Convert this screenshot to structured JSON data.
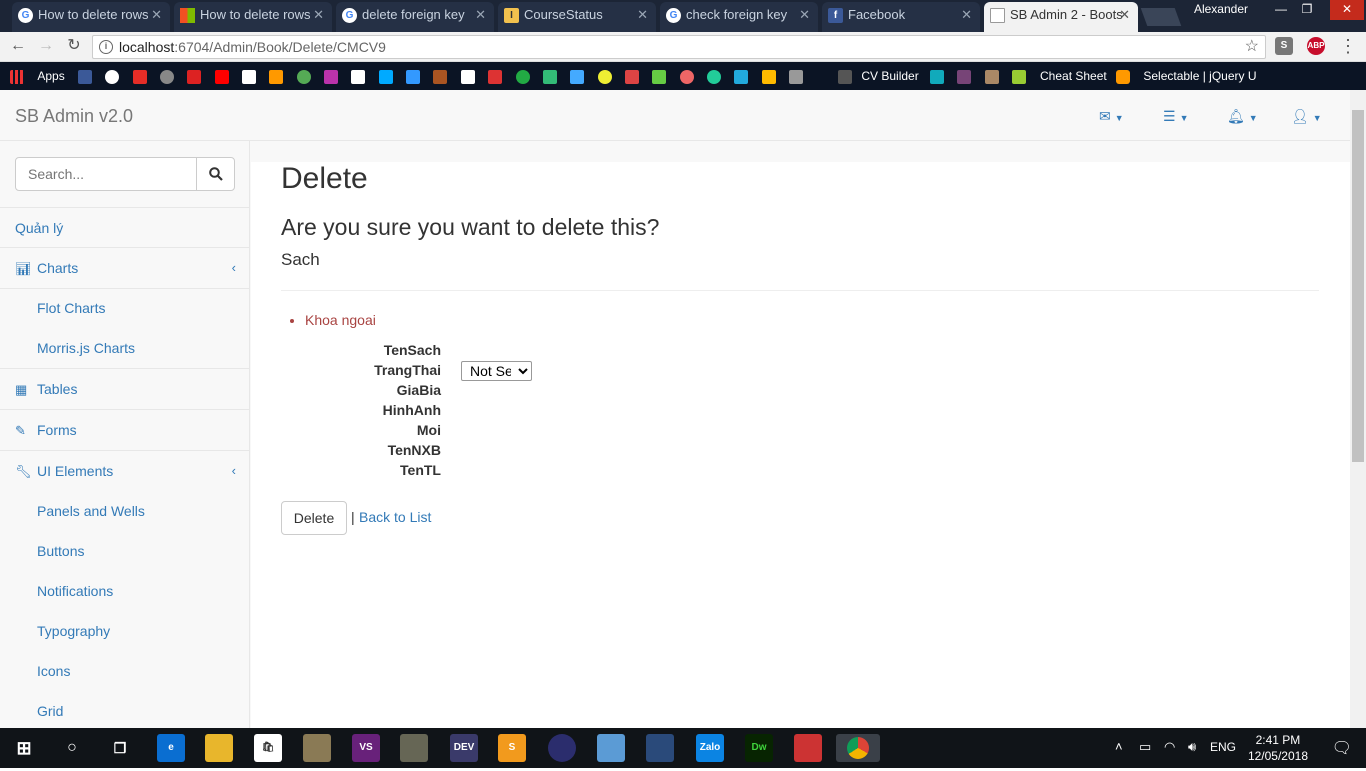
{
  "browser": {
    "tabs": [
      {
        "title": "How to delete rows",
        "fav": "google",
        "color": "#ffffff"
      },
      {
        "title": "How to delete rows",
        "fav": "microsoft",
        "color": "#ffffff"
      },
      {
        "title": "delete foreign key",
        "fav": "google",
        "color": "#ffffff"
      },
      {
        "title": "CourseStatus",
        "fav": "courses",
        "color": "#f2c14e"
      },
      {
        "title": "check foreign key",
        "fav": "google",
        "color": "#ffffff"
      },
      {
        "title": "Facebook",
        "fav": "facebook",
        "color": "#3b5998"
      },
      {
        "title": "SB Admin 2 - Boots",
        "fav": "page",
        "color": "#ffffff"
      }
    ],
    "profile_name": "Alexander",
    "url_host": "localhost",
    "url_path": ":6704/Admin/Book/Delete/CMCV9",
    "bookmarks": {
      "apps": "Apps",
      "cv_builder": "CV Builder",
      "cheat_sheet": "Cheat Sheet",
      "selectable": "Selectable | jQuery U"
    }
  },
  "app": {
    "brand": "SB Admin v2.0",
    "search_placeholder": "Search...",
    "sidebar": {
      "quanly": "Quản lý",
      "charts": "Charts",
      "flot": "Flot Charts",
      "morris": "Morris.js Charts",
      "tables": "Tables",
      "forms": "Forms",
      "ui": "UI Elements",
      "panels": "Panels and Wells",
      "buttons": "Buttons",
      "notifications": "Notifications",
      "typography": "Typography",
      "icons": "Icons",
      "grid": "Grid"
    }
  },
  "content": {
    "title": "Delete",
    "question": "Are you sure you want to delete this?",
    "entity": "Sach",
    "error": "Khoa ngoai",
    "fields": {
      "tensach": "TenSach",
      "trangthai": "TrangThai",
      "giabia": "GiaBia",
      "hinhanh": "HinhAnh",
      "moi": "Moi",
      "tennxb": "TenNXB",
      "tentl": "TenTL"
    },
    "trangthai_value": "Not Set",
    "delete_label": "Delete",
    "separator": "|",
    "back_label": "Back to List"
  },
  "taskbar": {
    "lang": "ENG",
    "time": "2:41 PM",
    "date": "12/05/2018"
  }
}
